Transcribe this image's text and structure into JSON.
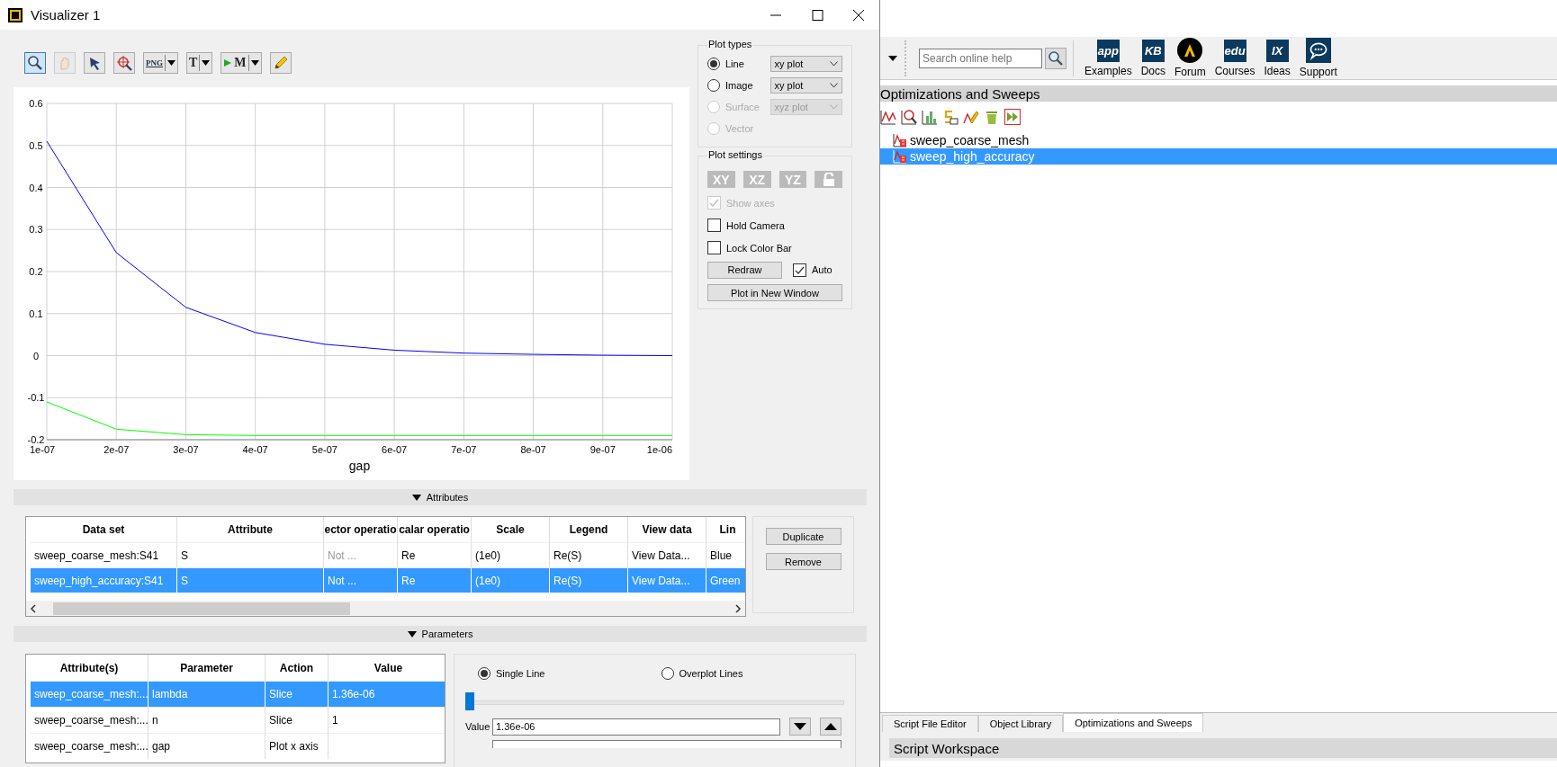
{
  "window": {
    "title": "Visualizer 1"
  },
  "toolbar": [
    {
      "kind": "zoom",
      "selected": true,
      "disabled": false,
      "dropdown": false
    },
    {
      "kind": "pan",
      "selected": false,
      "disabled": true,
      "dropdown": false
    },
    {
      "kind": "pointer",
      "selected": false,
      "disabled": false,
      "dropdown": false
    },
    {
      "kind": "target",
      "selected": false,
      "disabled": false,
      "dropdown": false
    },
    {
      "kind": "export",
      "label": "PNG",
      "selected": false,
      "disabled": false,
      "dropdown": true
    },
    {
      "kind": "text",
      "label": "T",
      "selected": false,
      "disabled": false,
      "dropdown": true
    },
    {
      "kind": "marker",
      "label": "M",
      "selected": false,
      "disabled": false,
      "dropdown": true
    },
    {
      "kind": "pencil",
      "selected": false,
      "disabled": false,
      "dropdown": false
    }
  ],
  "chart": {
    "chart_data": {
      "type": "line",
      "xlabel": "gap",
      "x": [
        1e-07,
        2e-07,
        3e-07,
        4e-07,
        5e-07,
        6e-07,
        7e-07,
        8e-07,
        9e-07,
        1e-06
      ],
      "series": [
        {
          "color": "#0000ff",
          "values": [
            0.51,
            0.245,
            0.115,
            0.055,
            0.027,
            0.013,
            0.006,
            0.003,
            0.001,
            0.0
          ]
        },
        {
          "color": "#00ff00",
          "values": [
            -0.11,
            -0.175,
            -0.188,
            -0.19,
            -0.19,
            -0.19,
            -0.19,
            -0.19,
            -0.19,
            -0.19
          ]
        }
      ],
      "xlim": [
        1e-07,
        1e-06
      ],
      "ylim": [
        -0.2,
        0.6
      ],
      "xticks": [
        {
          "value": 1e-07,
          "label": "1e-07"
        },
        {
          "value": 2e-07,
          "label": "2e-07"
        },
        {
          "value": 3e-07,
          "label": "3e-07"
        },
        {
          "value": 4e-07,
          "label": "4e-07"
        },
        {
          "value": 5e-07,
          "label": "5e-07"
        },
        {
          "value": 6e-07,
          "label": "6e-07"
        },
        {
          "value": 7e-07,
          "label": "7e-07"
        },
        {
          "value": 8e-07,
          "label": "8e-07"
        },
        {
          "value": 9e-07,
          "label": "9e-07"
        },
        {
          "value": 1e-06,
          "label": "1e-06"
        }
      ],
      "yticks": [
        -0.2,
        -0.1,
        0,
        0.1,
        0.2,
        0.3,
        0.4,
        0.5,
        0.6
      ],
      "grid": true
    }
  },
  "plot_types": {
    "title": "Plot types",
    "items": [
      {
        "label": "Line",
        "selected": true,
        "disabled": false,
        "dropdown": "xy plot"
      },
      {
        "label": "Image",
        "selected": false,
        "disabled": false,
        "dropdown": "xy plot"
      },
      {
        "label": "Surface",
        "selected": false,
        "disabled": true,
        "dropdown": "xyz plot"
      },
      {
        "label": "Vector",
        "selected": false,
        "disabled": true
      }
    ]
  },
  "plot_settings": {
    "title": "Plot settings",
    "views": [
      {
        "kind": "axes",
        "label": "XY"
      },
      {
        "kind": "axes",
        "label": "XZ"
      },
      {
        "kind": "axes",
        "label": "YZ"
      },
      {
        "kind": "lock"
      }
    ],
    "checks": [
      {
        "label": "Show axes",
        "checked": true,
        "disabled": true
      },
      {
        "label": "Hold Camera",
        "checked": false,
        "disabled": false
      },
      {
        "label": "Lock Color Bar",
        "checked": false,
        "disabled": false
      }
    ],
    "redraw": "Redraw",
    "auto": {
      "label": "Auto",
      "checked": true
    },
    "new_window": "Plot in New Window"
  },
  "attributes": {
    "title": "Attributes",
    "columns": [
      {
        "label": "Data set",
        "muted": false
      },
      {
        "label": "Attribute",
        "muted": false
      },
      {
        "label": "ector operatio",
        "muted": true
      },
      {
        "label": "calar operatio",
        "muted": false
      },
      {
        "label": "Scale",
        "muted": false
      },
      {
        "label": "Legend",
        "muted": false
      },
      {
        "label": "View data",
        "muted": false
      },
      {
        "label": "Lin",
        "muted": false
      }
    ],
    "rows": [
      {
        "selected": false,
        "cells": [
          "sweep_coarse_mesh:S41",
          "S",
          "Not ...",
          "Re",
          "(1e0)",
          "Re(S)",
          "View Data...",
          "Blue"
        ]
      },
      {
        "selected": true,
        "cells": [
          "sweep_high_accuracy:S41",
          "S",
          "Not ...",
          "Re",
          "(1e0)",
          "Re(S)",
          "View Data...",
          "Green"
        ]
      }
    ],
    "buttons": [
      "Duplicate",
      "Remove"
    ]
  },
  "parameters": {
    "title": "Parameters",
    "columns": [
      "Attribute(s)",
      "Parameter",
      "Action",
      "Value"
    ],
    "rows": [
      {
        "selected": true,
        "cells": [
          "sweep_coarse_mesh:...",
          "lambda",
          "Slice",
          "1.36e-06"
        ]
      },
      {
        "selected": false,
        "cells": [
          "sweep_coarse_mesh:...",
          "n",
          "Slice",
          "1"
        ]
      },
      {
        "selected": false,
        "cells": [
          "sweep_coarse_mesh:...",
          "gap",
          "Plot x axis",
          ""
        ]
      }
    ],
    "modes": [
      {
        "label": "Single Line",
        "selected": true
      },
      {
        "label": "Overplot Lines",
        "selected": false
      }
    ],
    "slider": {
      "level": 0
    },
    "value": {
      "label": "Value",
      "value": "1.36e-06"
    }
  },
  "help": {
    "placeholder": "Search online help",
    "links": [
      {
        "label": "Examples",
        "kind": "badge",
        "badge": "app"
      },
      {
        "label": "Docs",
        "kind": "badge",
        "badge": "KB"
      },
      {
        "label": "Forum",
        "kind": "logo"
      },
      {
        "label": "Courses",
        "kind": "badge",
        "badge": "edu"
      },
      {
        "label": "Ideas",
        "kind": "badge",
        "badge": "IX"
      },
      {
        "label": "Support",
        "kind": "chat"
      }
    ]
  },
  "sweeps": {
    "title": "Optimizations and Sweeps",
    "tools": [
      {
        "kind": "plot"
      },
      {
        "kind": "zoom"
      },
      {
        "kind": "histogram"
      },
      {
        "kind": "script"
      },
      {
        "kind": "edit"
      },
      {
        "kind": "trash"
      },
      {
        "kind": "run"
      }
    ],
    "items": [
      {
        "label": "sweep_coarse_mesh",
        "selected": false
      },
      {
        "label": "sweep_high_accuracy",
        "selected": true
      }
    ]
  },
  "tabs": [
    {
      "label": "Script File Editor",
      "selected": false
    },
    {
      "label": "Object Library",
      "selected": false
    },
    {
      "label": "Optimizations and Sweeps",
      "selected": true
    }
  ],
  "workspace": {
    "title": "Script Workspace"
  }
}
